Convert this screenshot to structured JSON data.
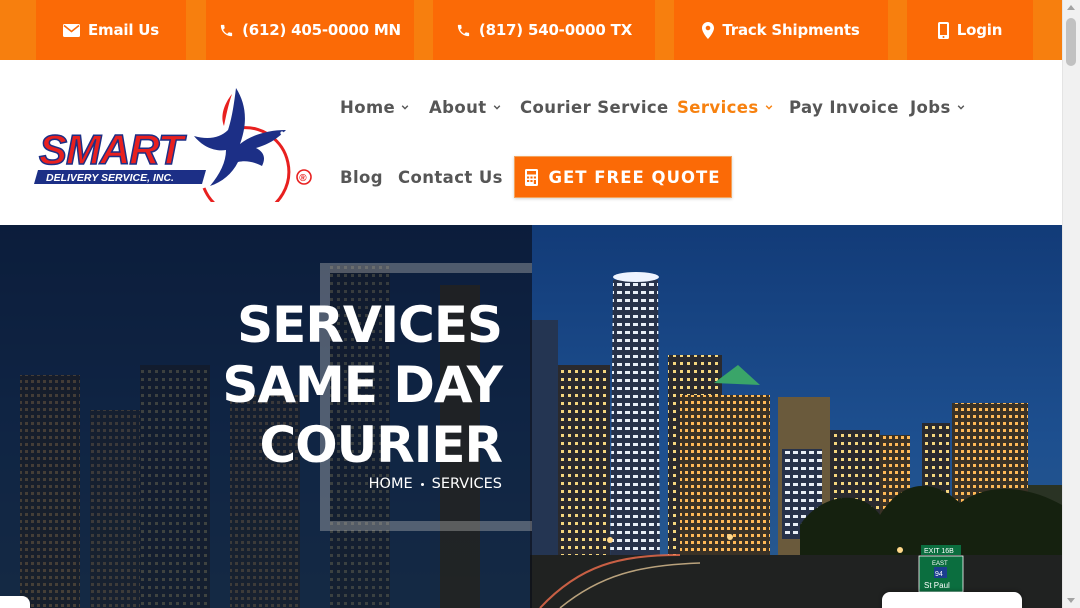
{
  "topbar": {
    "items": [
      {
        "label": "Email Us",
        "icon": "envelope-icon"
      },
      {
        "label": "(612) 405-0000 MN",
        "icon": "phone-icon"
      },
      {
        "label": "(817) 540-0000 TX",
        "icon": "phone-icon"
      },
      {
        "label": "Track Shipments",
        "icon": "map-pin-icon"
      },
      {
        "label": "Login",
        "icon": "mobile-icon"
      }
    ]
  },
  "logo": {
    "brand": "SMART",
    "tagline": "DELIVERY SERVICE, INC.",
    "registered": "®"
  },
  "nav": {
    "home": "Home",
    "about": "About",
    "courier_service": "Courier Service",
    "services": "Services",
    "pay_invoice": "Pay Invoice",
    "jobs": "Jobs",
    "blog": "Blog",
    "contact_us": "Contact Us",
    "quote_button": "GET FREE QUOTE"
  },
  "hero": {
    "title_line1": "SERVICES",
    "title_line2": "SAME DAY",
    "title_line3": "COURIER",
    "breadcrumb_home": "HOME",
    "breadcrumb_current": "SERVICES",
    "highway_sign_top": "EXIT 16B",
    "highway_sign_dir": "EAST",
    "highway_sign_num": "94",
    "highway_sign_city": "St Paul"
  },
  "colors": {
    "orange_bar": "#f77f0e",
    "orange_button": "#fb6a06",
    "nav_text": "#565656",
    "nav_active": "#f7810f",
    "logo_red": "#e8201f",
    "logo_navy": "#1c2f86"
  }
}
